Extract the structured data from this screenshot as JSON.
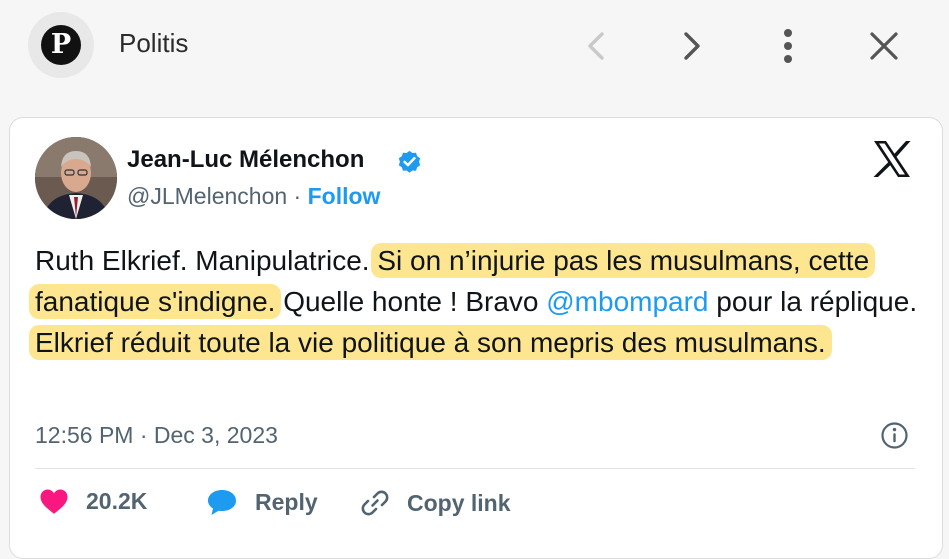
{
  "header": {
    "site_logo_letter": "P",
    "site_name": "Politis",
    "icons": [
      "chevron-left-icon",
      "chevron-right-icon",
      "more-vertical-icon",
      "close-icon"
    ]
  },
  "tweet": {
    "author_name": "Jean-Luc Mélenchon",
    "handle": "@JLMelenchon",
    "separator": " · ",
    "follow_label": "Follow",
    "text": {
      "part1": "Ruth Elkrief. Manipulatrice. ",
      "highlight1": "Si on n’injurie pas les musulmans, cette fanatique s'indigne.",
      "part2": " Quelle honte ! Bravo ",
      "mention": "@mbompard",
      "part3": " pour la réplique. ",
      "highlight2": "Elkrief réduit toute la vie politique à son mepris des musulmans."
    },
    "timestamp": "12:56 PM · Dec 3, 2023",
    "actions": {
      "likes": "20.2K",
      "reply_label": "Reply",
      "copy_label": "Copy link"
    }
  },
  "colors": {
    "accent_blue": "#1d9bf0",
    "like_pink": "#f91880",
    "highlight_yellow": "#fdd64c",
    "text_primary": "#0f1419",
    "text_secondary": "#536471"
  }
}
